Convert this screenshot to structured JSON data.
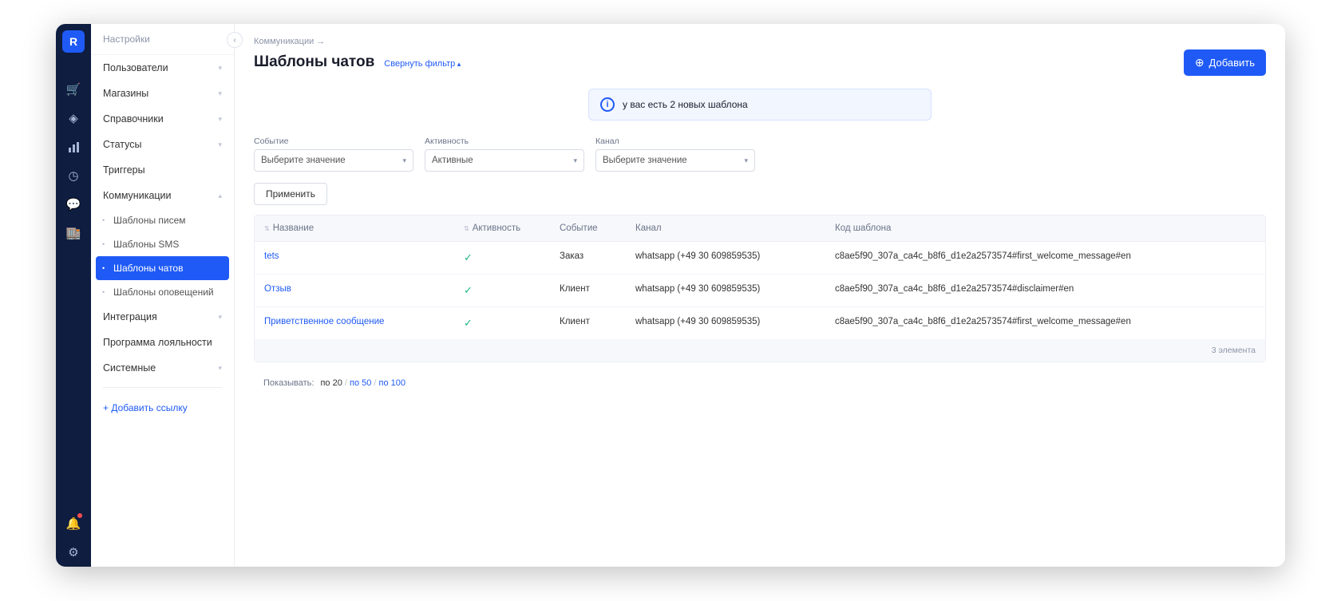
{
  "rail": {
    "logo_text": "R"
  },
  "secnav": {
    "title": "Настройки",
    "items": [
      {
        "label": "Пользователи",
        "expandable": true
      },
      {
        "label": "Магазины",
        "expandable": true
      },
      {
        "label": "Справочники",
        "expandable": true
      },
      {
        "label": "Статусы",
        "expandable": true
      },
      {
        "label": "Триггеры",
        "expandable": false
      },
      {
        "label": "Коммуникации",
        "expandable": true,
        "open": true,
        "children": [
          {
            "label": "Шаблоны писем"
          },
          {
            "label": "Шаблоны SMS"
          },
          {
            "label": "Шаблоны чатов",
            "active": true
          },
          {
            "label": "Шаблоны оповещений"
          }
        ]
      },
      {
        "label": "Интеграция",
        "expandable": true
      },
      {
        "label": "Программа лояльности",
        "expandable": false
      },
      {
        "label": "Системные",
        "expandable": true
      }
    ],
    "addlink": "Добавить ссылку"
  },
  "breadcrumb": "Коммуникации →",
  "page_title": "Шаблоны чатов",
  "filter_toggle": "Свернуть фильтр",
  "add_button": "Добавить",
  "banner": "у вас есть 2 новых шаблона",
  "filters": {
    "event": {
      "label": "Событие",
      "placeholder": "Выберите значение"
    },
    "activity": {
      "label": "Активность",
      "value": "Активные"
    },
    "channel": {
      "label": "Канал",
      "placeholder": "Выберите значение"
    }
  },
  "apply": "Применить",
  "columns": {
    "name": "Название",
    "activity": "Активность",
    "event": "Событие",
    "channel": "Канал",
    "code": "Код шаблона"
  },
  "rows": [
    {
      "name": "tets",
      "active": true,
      "event": "Заказ",
      "channel": "whatsapp (+49 30 609859535)",
      "code": "c8ae5f90_307a_ca4c_b8f6_d1e2a2573574#first_welcome_message#en"
    },
    {
      "name": "Отзыв",
      "active": true,
      "event": "Клиент",
      "channel": "whatsapp (+49 30 609859535)",
      "code": "c8ae5f90_307a_ca4c_b8f6_d1e2a2573574#disclaimer#en"
    },
    {
      "name": "Приветственное сообщение",
      "active": true,
      "event": "Клиент",
      "channel": "whatsapp (+49 30 609859535)",
      "code": "c8ae5f90_307a_ca4c_b8f6_d1e2a2573574#first_welcome_message#en"
    }
  ],
  "total": "3 элемента",
  "pager": {
    "label": "Показывать:",
    "options": [
      "по 20",
      "по 50",
      "по 100"
    ],
    "active": "по 20"
  }
}
